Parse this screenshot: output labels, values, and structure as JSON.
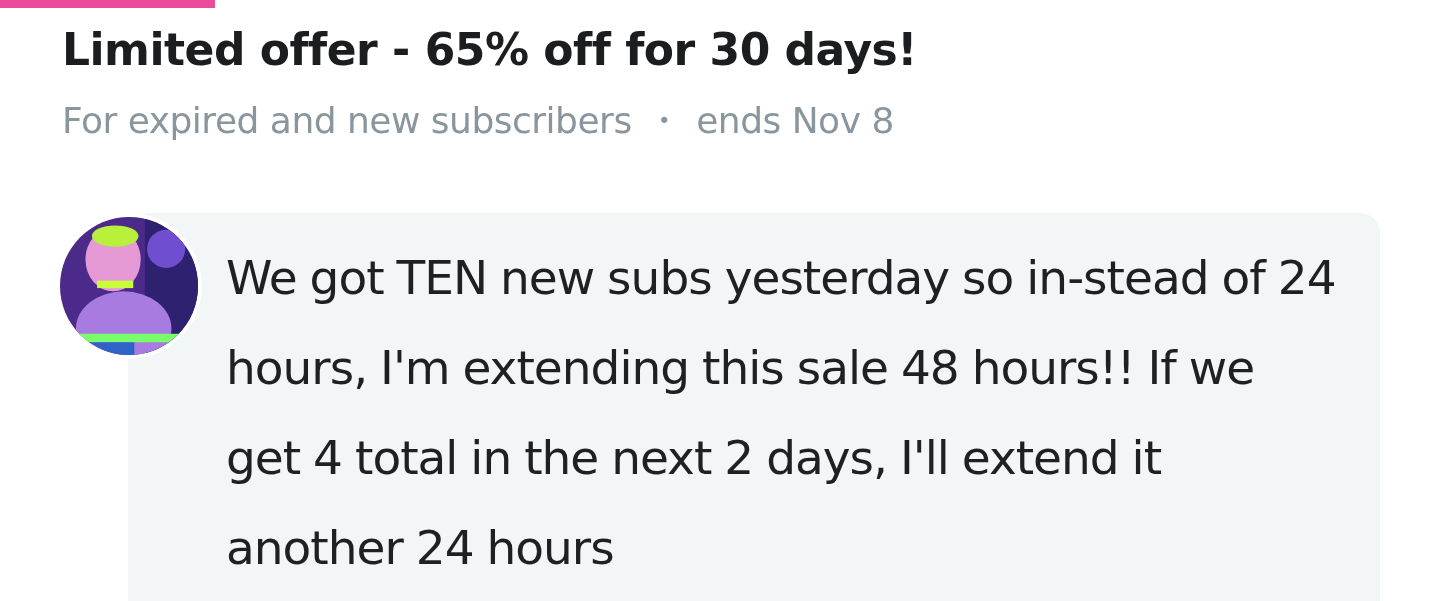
{
  "offer": {
    "title": "Limited offer - 65% off for 30 days!",
    "audience": "For expired and new subscribers",
    "separator": "•",
    "ends": "ends Nov 8"
  },
  "message": {
    "text": "We got TEN new subs yesterday so in-stead of 24 hours, I'm extending this sale 48 hours!! If we get 4 total in the next 2 days, I'll extend it another 24 hours"
  }
}
